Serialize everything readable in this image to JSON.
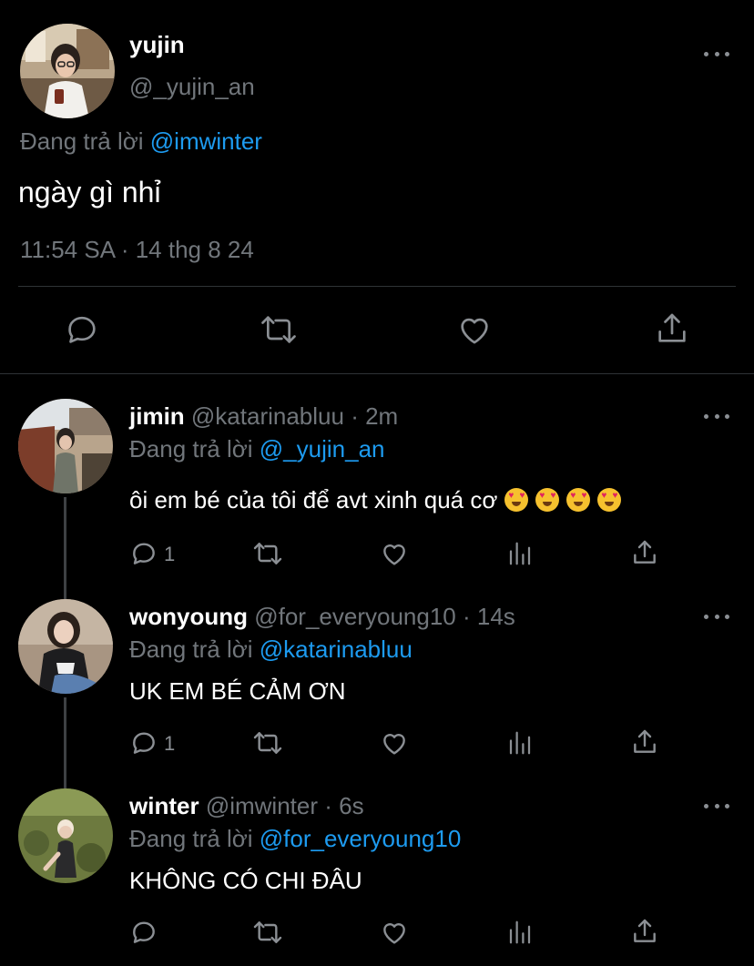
{
  "main_tweet": {
    "name": "yujin",
    "handle": "@_yujin_an",
    "replying_prefix": "Đang trả lời ",
    "replying_to": "@imwinter",
    "text": "ngày gì nhỉ",
    "timestamp": "11:54 SA · 14 thg 8 24",
    "actions": [
      "reply-icon",
      "retweet-icon",
      "like-icon",
      "share-icon"
    ]
  },
  "replies": [
    {
      "name": "jimin",
      "handle": "@katarinabluu",
      "time": "· 2m",
      "replying_prefix": "Đang trả lời ",
      "replying_to": "@_yujin_an",
      "text": "ôi em bé của tôi để avt xinh quá cơ",
      "emoji": [
        "heart-eyes-emoji",
        "heart-eyes-emoji",
        "heart-eyes-emoji",
        "heart-eyes-emoji"
      ],
      "reply_count": "1"
    },
    {
      "name": "wonyoung",
      "handle": "@for_everyoung10",
      "time": "· 14s",
      "replying_prefix": "Đang trả lời ",
      "replying_to": "@katarinabluu",
      "text": "UK EM BÉ CẢM ƠN",
      "reply_count": "1"
    },
    {
      "name": "winter",
      "handle": "@imwinter",
      "time": "· 6s",
      "replying_prefix": "Đang trả lời ",
      "replying_to": "@for_everyoung10",
      "text": "KHÔNG CÓ CHI ĐÂU",
      "reply_count": ""
    }
  ],
  "colors": {
    "background": "#000000",
    "text": "#e7e9ea",
    "muted": "#71767b",
    "link": "#1d9bf0",
    "divider": "#2f3336"
  }
}
